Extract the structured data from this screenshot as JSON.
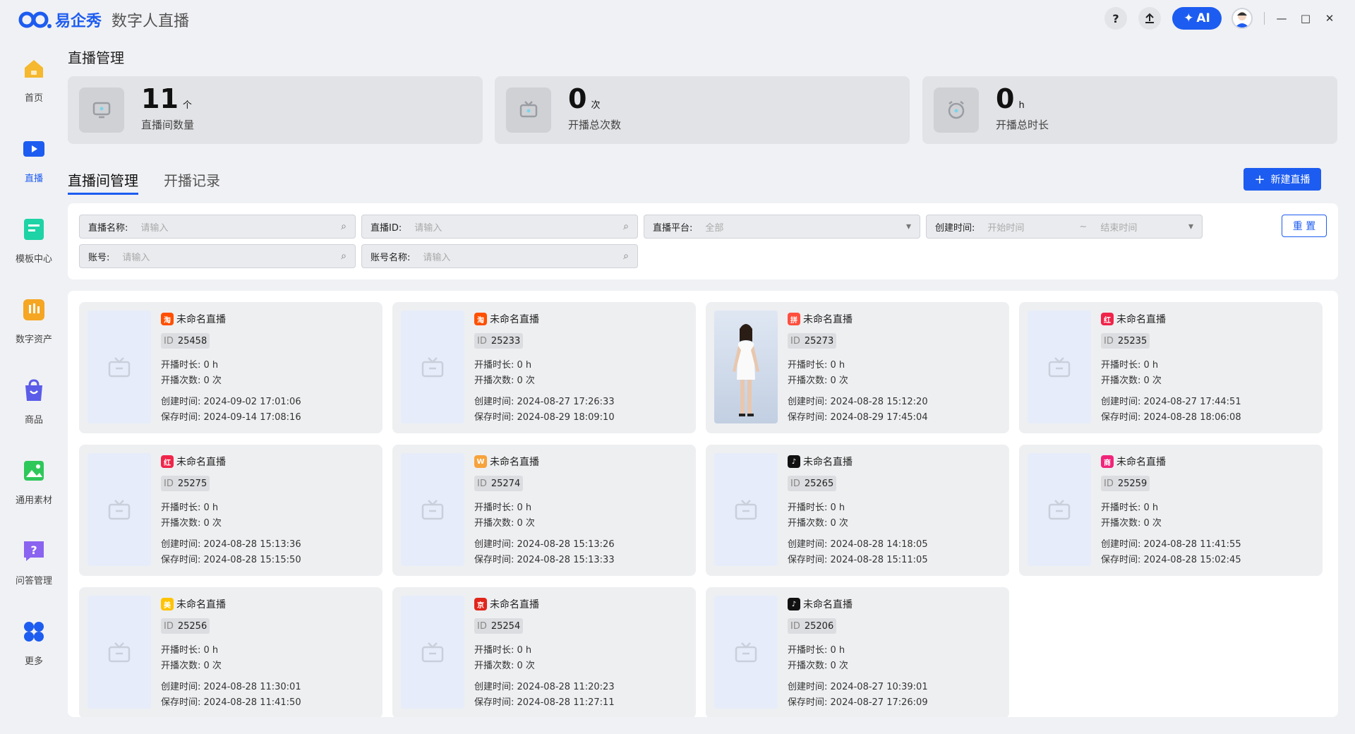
{
  "app": {
    "brand": "易企秀",
    "name": "数字人直播"
  },
  "titlebar": {
    "help_icon": "question-icon",
    "upload_icon": "upload-icon",
    "ai_label": "AI",
    "minimize": "—",
    "maximize": "□",
    "close": "✕"
  },
  "sidebar": {
    "items": [
      {
        "label": "首页",
        "icon": "home-icon",
        "color": "#f5b82e",
        "active": false
      },
      {
        "label": "直播",
        "icon": "live-icon",
        "color": "#1d5cf0",
        "active": true
      },
      {
        "label": "模板中心",
        "icon": "template-icon",
        "color": "#1ed3a5",
        "active": false
      },
      {
        "label": "数字资产",
        "icon": "asset-icon",
        "color": "#f5a623",
        "active": false
      },
      {
        "label": "商品",
        "icon": "bag-icon",
        "color": "#5b5ce8",
        "active": false
      },
      {
        "label": "通用素材",
        "icon": "image-icon",
        "color": "#2ec85a",
        "active": false
      },
      {
        "label": "问答管理",
        "icon": "qa-icon",
        "color": "#8a63f0",
        "active": false
      },
      {
        "label": "更多",
        "icon": "more-icon",
        "color": "#1d5cf0",
        "active": false
      }
    ]
  },
  "page_title": "直播管理",
  "stats": [
    {
      "value": "11",
      "unit": "个",
      "label": "直播间数量"
    },
    {
      "value": "0",
      "unit": "次",
      "label": "开播总次数"
    },
    {
      "value": "0",
      "unit": "h",
      "label": "开播总时长"
    }
  ],
  "tabs": [
    {
      "label": "直播间管理",
      "active": true
    },
    {
      "label": "开播记录",
      "active": false
    }
  ],
  "new_button": "新建直播",
  "filters": {
    "name": {
      "label": "直播名称:",
      "placeholder": "请输入"
    },
    "id": {
      "label": "直播ID:",
      "placeholder": "请输入"
    },
    "platform": {
      "label": "直播平台:",
      "value": "全部"
    },
    "created": {
      "label": "创建时间:",
      "start": "开始时间",
      "sep": "~",
      "end": "结束时间"
    },
    "account": {
      "label": "账号:",
      "placeholder": "请输入"
    },
    "account_name": {
      "label": "账号名称:",
      "placeholder": "请输入"
    },
    "reset": "重 置"
  },
  "card_labels": {
    "id": "ID",
    "duration": "开播时长:",
    "count": "开播次数:",
    "created": "创建时间:",
    "saved": "保存时间:"
  },
  "cards": [
    {
      "title": "未命名直播",
      "platform": "taobao",
      "platform_color": "#ff5000",
      "platform_glyph": "淘",
      "id": "25458",
      "duration": "0 h",
      "count": "0 次",
      "created": "2024-09-02 17:01:06",
      "saved": "2024-09-14 17:08:16",
      "has_image": false
    },
    {
      "title": "未命名直播",
      "platform": "taobao",
      "platform_color": "#ff5000",
      "platform_glyph": "淘",
      "id": "25233",
      "duration": "0 h",
      "count": "0 次",
      "created": "2024-08-27 17:26:33",
      "saved": "2024-08-29 18:09:10",
      "has_image": false
    },
    {
      "title": "未命名直播",
      "platform": "pinduoduo",
      "platform_color": "#ff4f3e",
      "platform_glyph": "拼",
      "id": "25273",
      "duration": "0 h",
      "count": "0 次",
      "created": "2024-08-28 15:12:20",
      "saved": "2024-08-29 17:45:04",
      "has_image": true
    },
    {
      "title": "未命名直播",
      "platform": "xiaohongshu",
      "platform_color": "#f0254a",
      "platform_glyph": "红",
      "id": "25235",
      "duration": "0 h",
      "count": "0 次",
      "created": "2024-08-27 17:44:51",
      "saved": "2024-08-28 18:06:08",
      "has_image": false
    },
    {
      "title": "未命名直播",
      "platform": "xiaohongshu",
      "platform_color": "#f0254a",
      "platform_glyph": "红",
      "id": "25275",
      "duration": "0 h",
      "count": "0 次",
      "created": "2024-08-28 15:13:36",
      "saved": "2024-08-28 15:15:50",
      "has_image": false
    },
    {
      "title": "未命名直播",
      "platform": "weishi",
      "platform_color": "#f7a33c",
      "platform_glyph": "W",
      "id": "25274",
      "duration": "0 h",
      "count": "0 次",
      "created": "2024-08-28 15:13:26",
      "saved": "2024-08-28 15:13:33",
      "has_image": false
    },
    {
      "title": "未命名直播",
      "platform": "douyin",
      "platform_color": "#111111",
      "platform_glyph": "♪",
      "id": "25265",
      "duration": "0 h",
      "count": "0 次",
      "created": "2024-08-28 14:18:05",
      "saved": "2024-08-28 15:11:05",
      "has_image": false
    },
    {
      "title": "未命名直播",
      "platform": "douyin-mall",
      "platform_color": "#f0257a",
      "platform_glyph": "商",
      "id": "25259",
      "duration": "0 h",
      "count": "0 次",
      "created": "2024-08-28 11:41:55",
      "saved": "2024-08-28 15:02:45",
      "has_image": false
    },
    {
      "title": "未命名直播",
      "platform": "meituan",
      "platform_color": "#ffc300",
      "platform_glyph": "美",
      "id": "25256",
      "duration": "0 h",
      "count": "0 次",
      "created": "2024-08-28 11:30:01",
      "saved": "2024-08-28 11:41:50",
      "has_image": false
    },
    {
      "title": "未命名直播",
      "platform": "jd",
      "platform_color": "#e1251b",
      "platform_glyph": "京",
      "id": "25254",
      "duration": "0 h",
      "count": "0 次",
      "created": "2024-08-28 11:20:23",
      "saved": "2024-08-28 11:27:11",
      "has_image": false
    },
    {
      "title": "未命名直播",
      "platform": "douyin",
      "platform_color": "#111111",
      "platform_glyph": "♪",
      "id": "25206",
      "duration": "0 h",
      "count": "0 次",
      "created": "2024-08-27 10:39:01",
      "saved": "2024-08-27 17:26:09",
      "has_image": false
    }
  ]
}
